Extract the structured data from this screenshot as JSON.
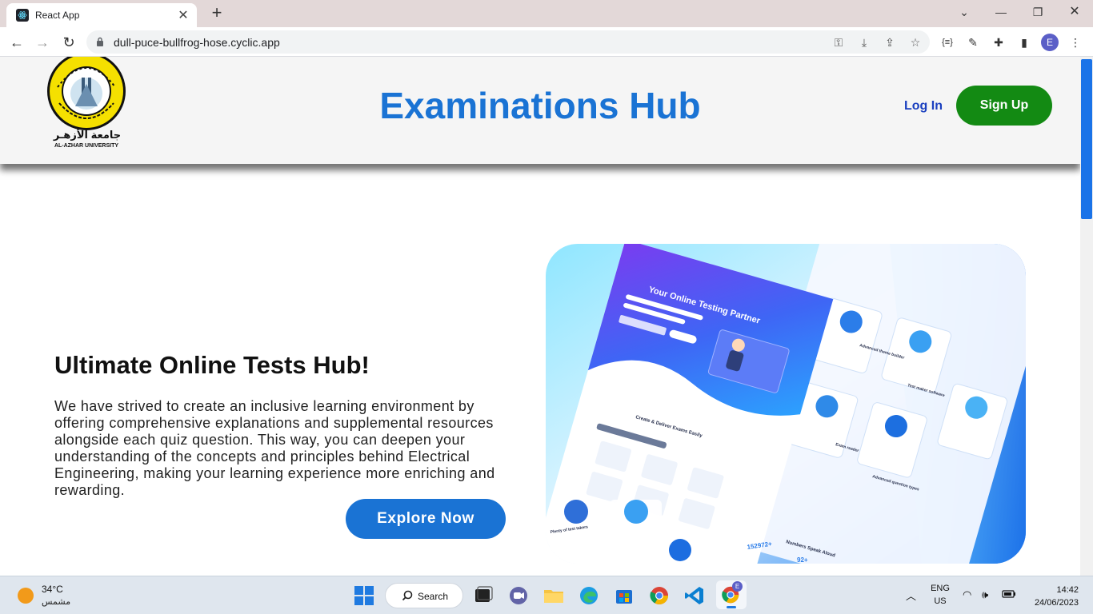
{
  "browser": {
    "tab_title": "React App",
    "url": "dull-puce-bullfrog-hose.cyclic.app",
    "profile_initial": "E"
  },
  "header": {
    "logo_arabic": "جامعة الأزهـر",
    "logo_english": "AL-AZHAR UNIVERSITY",
    "title": "Examinations Hub",
    "login_label": "Log In",
    "signup_label": "Sign Up"
  },
  "hero": {
    "title": "Ultimate Online Tests Hub!",
    "text": "We have strived to create an inclusive learning environment by offering comprehensive explanations and supplemental resources alongside each quiz question. This way, you can deepen your understanding of the concepts and principles behind Electrical Engineering, making your learning experience more enriching and rewarding.",
    "cta_label": "Explore Now",
    "image": {
      "headline": "Your Online Testing Partner",
      "section_title": "Create & Deliver Exams Easily",
      "stat_1": "152972+",
      "stat_2": "92+",
      "stats_title": "Numbers Speak Aloud",
      "card_labels": [
        "Advanced theme builder",
        "Test maker software",
        "Exam reader",
        "Advanced question types",
        "Plenty of test takers"
      ]
    }
  },
  "taskbar": {
    "temperature": "34°C",
    "weather_desc": "مشمس",
    "search_label": "Search",
    "lang_1": "ENG",
    "lang_2": "US",
    "time": "14:42",
    "date": "24/06/2023"
  },
  "colors": {
    "brand_blue": "#1a73d4",
    "signup_green": "#138a13",
    "login_blue": "#1a3fbf"
  }
}
